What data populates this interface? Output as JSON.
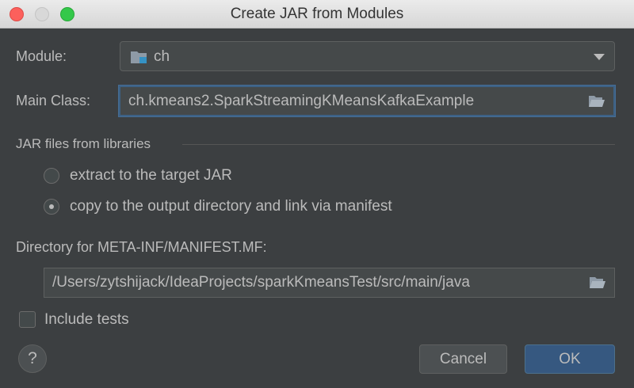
{
  "window": {
    "title": "Create JAR from Modules"
  },
  "form": {
    "module_label": "Module:",
    "module_value": "ch",
    "main_class_label": "Main Class:",
    "main_class_value": "ch.kmeans2.SparkStreamingKMeansKafkaExample",
    "jar_section_title": "JAR files from libraries",
    "options": [
      {
        "label": "extract to the target JAR",
        "checked": false
      },
      {
        "label": "copy to the output directory and link via manifest",
        "checked": true
      }
    ],
    "manifest_label": "Directory for META-INF/MANIFEST.MF:",
    "manifest_value": "/Users/zytshijack/IdeaProjects/sparkKmeansTest/src/main/java",
    "include_tests_label": "Include tests",
    "include_tests_checked": false
  },
  "buttons": {
    "help": "?",
    "cancel": "Cancel",
    "ok": "OK"
  },
  "colors": {
    "background": "#3c3f41",
    "focus_border": "#3d6185",
    "ok_button": "#365880",
    "text": "#bbbbbb"
  }
}
